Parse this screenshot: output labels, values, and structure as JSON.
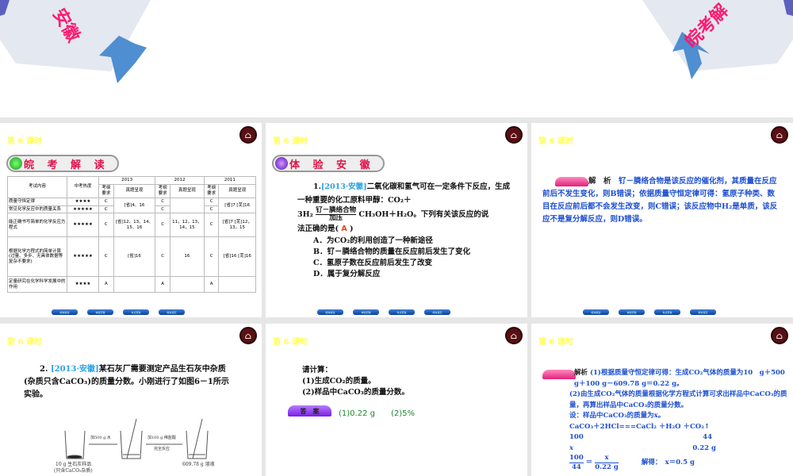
{
  "top_banner": {
    "left_text": "安徽",
    "right_text": "皖考解"
  },
  "slide_header": "第 6 课时",
  "nav_buttons": [
    "皖考解读",
    "体验安徽",
    "考点聚焦",
    "皖考探究"
  ],
  "slide1": {
    "section_title": "皖 考 解 读",
    "table": {
      "col_content": "考试内容",
      "col_heat": "中考热度",
      "years": [
        "2013",
        "2012",
        "2011"
      ],
      "sub_req": "考纲要求",
      "sub_real": "真题呈现",
      "rows": [
        {
          "content": "质量守恒定律",
          "heat": "★★★★",
          "r13": "C",
          "r12": "C",
          "r11": "C"
        },
        {
          "content": "常见化学反应中的质量关系",
          "heat": "★★★★★",
          "r13": "C",
          "r12": "C",
          "r11": "C"
        },
        {
          "content": "能正确书写简单的化学反应方程式",
          "heat": "★★★★★",
          "r13": "C",
          "p13": "[省]12、13、14、15、16",
          "r12": "C",
          "p12": "11，12，13，14，15",
          "r11": "C",
          "p11": "[省]7 [芜]12，13，15"
        },
        {
          "content": "根据化学方程式的简单计算(过量、多步、无具体数据等复杂不要求)",
          "heat": "★★★★★",
          "r13": "C",
          "p13": "[省]16",
          "r12": "C",
          "p12": "16",
          "r11": "C",
          "p11": "[省]16 [芜]16"
        },
        {
          "content": "定量研究在化学科学发展中的作用",
          "heat": "★★★★",
          "r13": "A",
          "r12": "A",
          "r11": "A"
        }
      ],
      "merged_p13": "[省]4、16",
      "merged_p11": "[省]7 [芜]16"
    }
  },
  "slide2": {
    "section_title": "体 验 安 徽",
    "num": "1.",
    "cite": "[2013·安徽]",
    "stem1": "二氧化碳和氢气可在一定条件下反应，生成一种重要的化工原料甲醇：CO₂＋",
    "stem2a": "3H₂",
    "cond_top": "钌－膦络合物",
    "cond_bottom": "加压",
    "stem2b": "CH₃OH＋H₂O。下列有关该反应的说",
    "stem3": "法正确的是(",
    "answer": "A",
    "stem3_end": ")",
    "options": [
      "A．为CO₂的利用创造了一种新途径",
      "B．钌－膦络合物的质量在反应前后发生了变化",
      "C．氢原子数在反应前后发生了改变",
      "D．属于复分解反应"
    ]
  },
  "slide3": {
    "label": "解　析",
    "text": "钌－膦络合物是该反应的催化剂，其质量在反应前后不发生变化，则B错误；依据质量守恒定律可得：氢原子种类、数目在反应前后都不会发生改变，则C错误；该反应物中H₂是单质，该反应不是复分解反应，则D错误。"
  },
  "slide4": {
    "num": "2.",
    "cite": "[2013·安徽]",
    "stem": "某石灰厂需要测定产品生石灰中杂质(杂质只含CaCO₃)的质量分数。小刚进行了如图6－1所示实验。",
    "fig": {
      "step1": "加500 g 水",
      "step2": "加100 g 稀盐酸",
      "step2b": "完全反应",
      "sample": "10 g 生石灰样品",
      "sample2": "(只含CaCO₃杂质)",
      "result": "609.78 g 溶液"
    }
  },
  "slide5": {
    "prompt": "请计算：",
    "q1": "(1)生成CO₂的质量。",
    "q2": "(2)样品中CaCO₃的质量分数。",
    "label": "答　案",
    "a1": "(1)0.22 g",
    "a2": "(2)5%"
  },
  "slide6": {
    "label": "解析",
    "lines": [
      "(1)根据质量守恒定律可得：生成CO₂气体的质量为10　g＋500 g＋100 g－609.78 g＝0.22 g。",
      "(2)由生成CO₂气体的质量根据化学方程式计算可求出样品中CaCO₃的质量，再算出样品中CaCO₃的质量分数。",
      "设：样品中CaCO₃的质量为x。",
      "CaCO₃＋2HCl===CaCl₂ ＋H₂O ＋CO₂↑"
    ],
    "m1": "100",
    "m2": "44",
    "v1": "x",
    "v2": "0.22 g",
    "frac_l_top": "100",
    "frac_l_bot": "44",
    "frac_r_top": "x",
    "frac_r_bot": "0.22 g",
    "solve": "解得：　x＝0.5 g"
  }
}
